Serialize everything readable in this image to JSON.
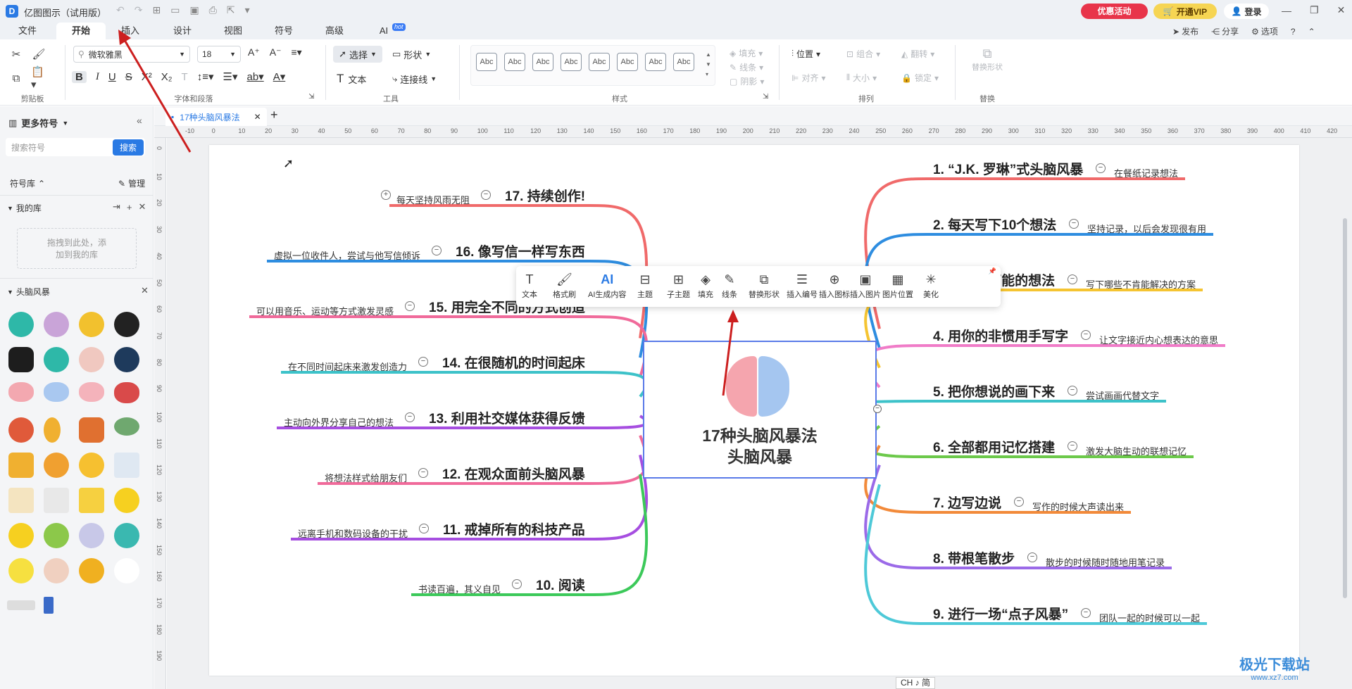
{
  "app": {
    "title": "亿图图示（试用版）",
    "promo": "优惠活动",
    "vip": "开通VIP",
    "login": "登录"
  },
  "menu": {
    "tabs": [
      "文件",
      "开始",
      "插入",
      "设计",
      "视图",
      "符号",
      "高级",
      "AI"
    ],
    "ai_badge": "hot",
    "right": [
      "发布",
      "分享",
      "选项"
    ]
  },
  "ribbon": {
    "font_name": "微软雅黑",
    "font_size": "18",
    "select": "选择",
    "shape": "形状",
    "text": "文本",
    "connector": "连接线",
    "style_box": "Abc",
    "fill": "填充",
    "line": "线条",
    "shadow": "阴影",
    "position": "位置",
    "align": "对齐",
    "group": "组合",
    "size": "大小",
    "flip": "翻转",
    "lock": "锁定",
    "replace_shape": "替换形状",
    "groups": [
      "剪贴板",
      "字体和段落",
      "工具",
      "样式",
      "排列",
      "替换"
    ]
  },
  "sidebar": {
    "title": "更多符号",
    "search_placeholder": "搜索符号",
    "search_button": "搜索",
    "library": "符号库",
    "manage": "管理",
    "my_library": "我的库",
    "drop_hint": "拖拽到此处，添加到我的库",
    "category": "头脑风暴"
  },
  "document": {
    "tab": "17种头脑风暴法"
  },
  "ruler": {
    "h_ticks": [
      "-10",
      "0",
      "10",
      "20",
      "30",
      "40",
      "50",
      "60",
      "70",
      "80",
      "90",
      "100",
      "110",
      "120",
      "130",
      "140",
      "150",
      "160",
      "170",
      "180",
      "190",
      "200",
      "210",
      "220",
      "230",
      "240",
      "250",
      "260",
      "270",
      "280",
      "290",
      "300",
      "310",
      "320",
      "330",
      "340",
      "350",
      "360",
      "370",
      "380",
      "390",
      "400",
      "410",
      "420"
    ],
    "v_ticks": [
      "0",
      "10",
      "20",
      "30",
      "40",
      "50",
      "60",
      "70",
      "80",
      "90",
      "100",
      "110",
      "120",
      "130",
      "140",
      "150",
      "160",
      "170",
      "180",
      "190"
    ]
  },
  "mindmap": {
    "center_line1": "17种头脑风暴法",
    "center_line2": "头脑风暴",
    "right": [
      {
        "title": "1. “J.K. 罗琳”式头脑风暴",
        "sub": "在餐纸记录想法",
        "color": "#f06a6a"
      },
      {
        "title": "2. 每天写下10个想法",
        "sub": "坚持记录，以后会发现很有用",
        "color": "#2e8de0"
      },
      {
        "title": "3. 每个不可能的想法",
        "sub": "写下哪些不肯能解决的方案",
        "color": "#f5c431"
      },
      {
        "title": "4. 用你的非惯用手写字",
        "sub": "让文字接近内心想表达的意思",
        "color": "#f07cc8"
      },
      {
        "title": "5. 把你想说的画下来",
        "sub": "尝试画画代替文字",
        "color": "#3dc2c9"
      },
      {
        "title": "6. 全部都用记忆搭建",
        "sub": "激发大脑生动的联想记忆",
        "color": "#6cc94a"
      },
      {
        "title": "7. 边写边说",
        "sub": "写作的时候大声读出来",
        "color": "#f28a3a"
      },
      {
        "title": "8. 带根笔散步",
        "sub": "散步的时候随时随地用笔记录",
        "color": "#9b6ae8"
      },
      {
        "title": "9. 进行一场“点子风暴”",
        "sub": "团队一起的时候可以一起",
        "color": "#4ec9d8"
      }
    ],
    "left": [
      {
        "title": "17. 持续创作!",
        "sub": "每天坚持风雨无阻",
        "color": "#f06a6a"
      },
      {
        "title": "16. 像写信一样写东西",
        "sub": "虚拟一位收件人，尝试与他写信倾诉",
        "color": "#2e8de0"
      },
      {
        "title": "15. 用完全不同的方式创造",
        "sub": "可以用音乐、运动等方式激发灵感",
        "color": "#f06a9a"
      },
      {
        "title": "14. 在很随机的时间起床",
        "sub": "在不同时间起床来激发创造力",
        "color": "#3dc2c9"
      },
      {
        "title": "13. 利用社交媒体获得反馈",
        "sub": "主动向外界分享自己的想法",
        "color": "#a64ee0"
      },
      {
        "title": "12. 在观众面前头脑风暴",
        "sub": "将想法样式给朋友们",
        "color": "#f06a9a"
      },
      {
        "title": "11. 戒掉所有的科技产品",
        "sub": "远离手机和数码设备的干扰",
        "color": "#a64ee0"
      },
      {
        "title": "10. 阅读",
        "sub": "书读百遍，其义自见",
        "color": "#3cc95a"
      }
    ]
  },
  "context_toolbar": [
    "文本",
    "格式刷",
    "AI生成内容",
    "主题",
    "子主题",
    "填充",
    "线条",
    "替换形状",
    "插入编号",
    "插入图标",
    "插入图片",
    "图片位置",
    "美化"
  ],
  "status": {
    "ime": "CH ♪ 简"
  },
  "watermark": {
    "text": "极光下载站",
    "url": "www.xz7.com"
  }
}
